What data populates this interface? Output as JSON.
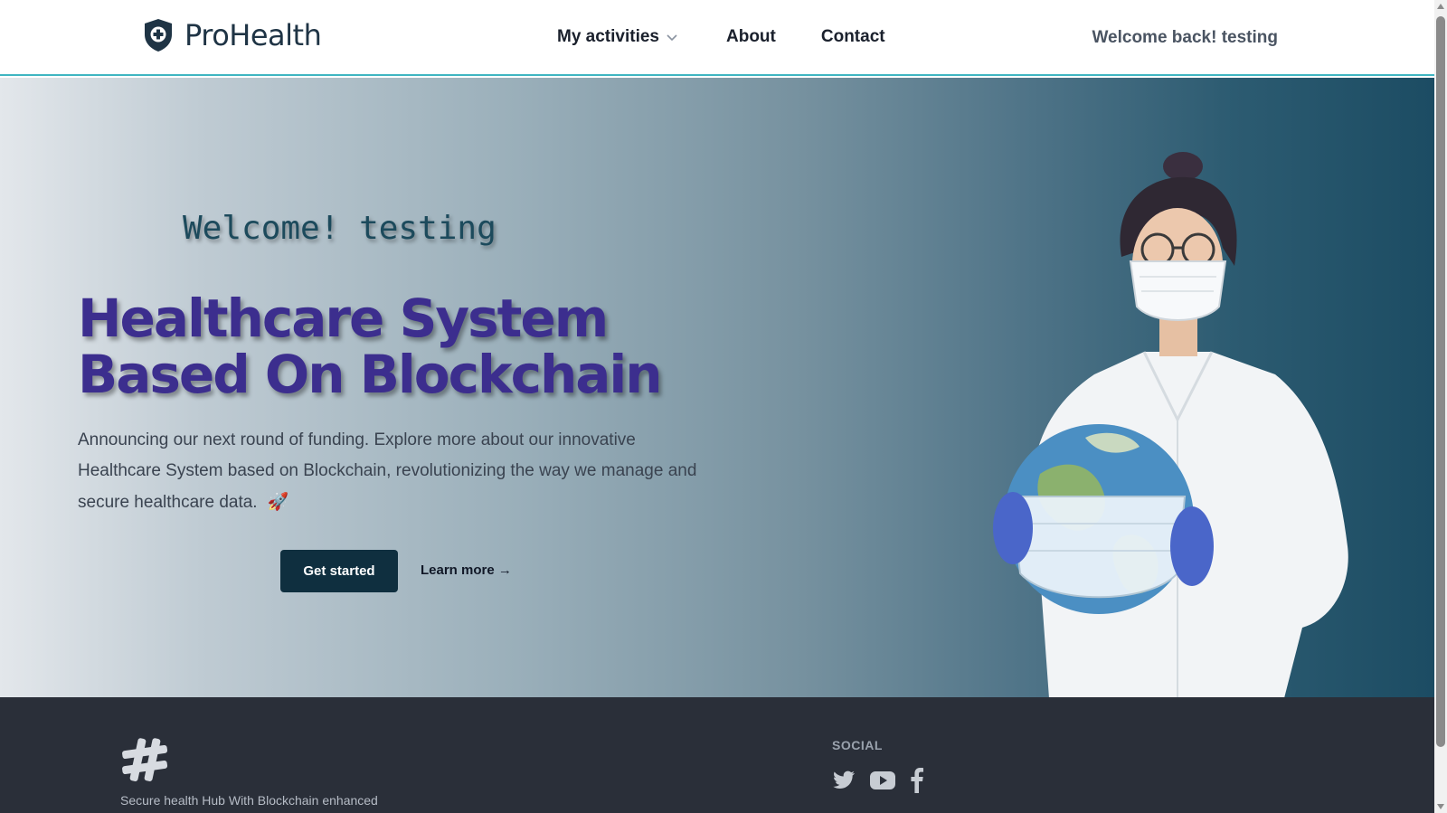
{
  "header": {
    "brand": "ProHealth",
    "logo_icon": "shield-plus-icon",
    "nav": [
      {
        "label": "My activities",
        "icon": "chevron-down-icon"
      },
      {
        "label": "About"
      },
      {
        "label": "Contact"
      }
    ],
    "welcome_text": "Welcome back! testing"
  },
  "hero": {
    "welcome": "Welcome! testing",
    "title": "Healthcare System Based On Blockchain",
    "description": "Announcing our next round of funding. Explore more about our innovative Healthcare System based on Blockchain, revolutionizing the way we manage and secure healthcare data.",
    "description_emoji": "🚀",
    "primary_button": "Get started",
    "secondary_link": "Learn more →",
    "image": "doctor-holding-masked-globe"
  },
  "footer": {
    "logo_icon": "hash-icon",
    "tagline": "Secure health Hub With Blockchain enhanced",
    "social_title": "SOCIAL",
    "social_icons": [
      "twitter-icon",
      "youtube-icon",
      "facebook-icon"
    ]
  },
  "colors": {
    "accent_border": "#3fb5c1",
    "title_purple": "#3c2e8e",
    "button_dark": "#0f2f3f",
    "footer_bg": "#2a2f39"
  }
}
